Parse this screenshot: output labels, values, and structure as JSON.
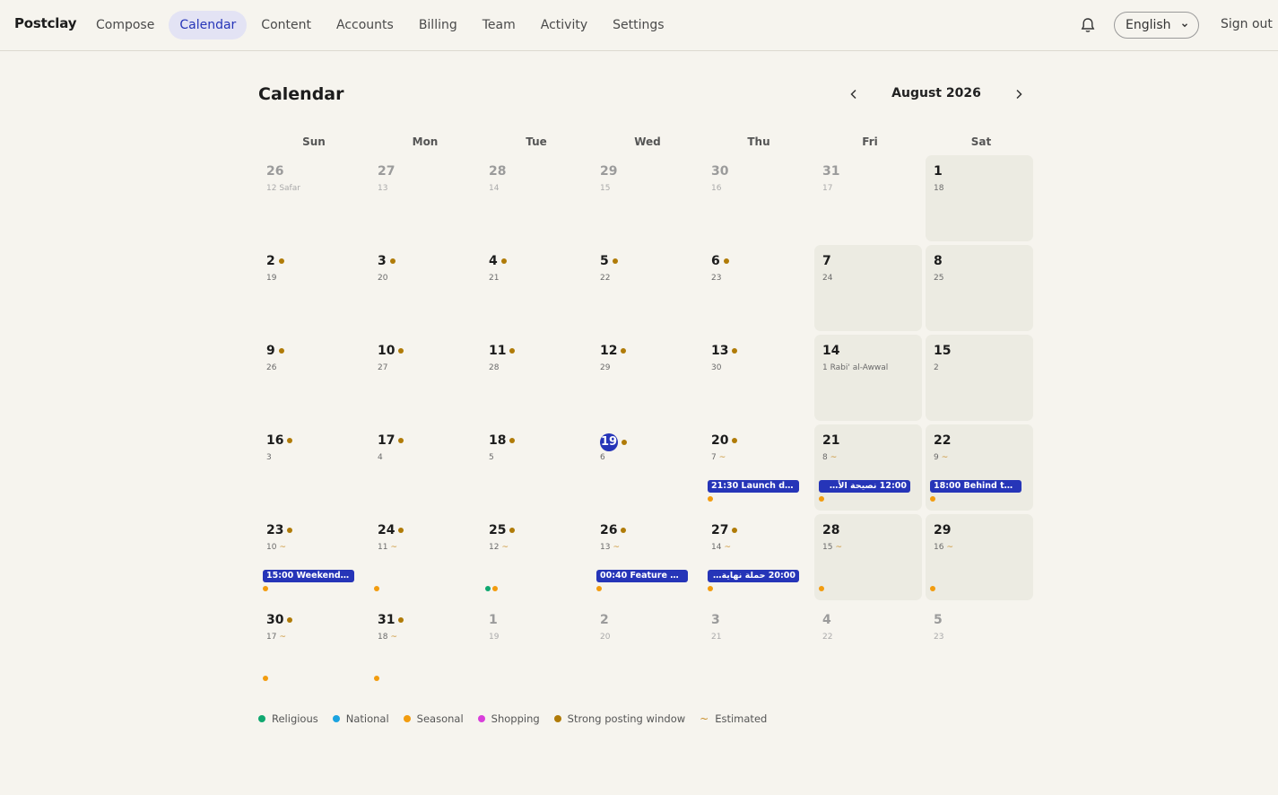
{
  "app": {
    "brand": "Postclay"
  },
  "nav": [
    "Compose",
    "Calendar",
    "Content",
    "Accounts",
    "Billing",
    "Team",
    "Activity",
    "Settings"
  ],
  "nav_active": 1,
  "header": {
    "language": "English",
    "sign_out": "Sign out"
  },
  "page": {
    "title": "Calendar",
    "month_label": "August 2026"
  },
  "weekdays": [
    "Sun",
    "Mon",
    "Tue",
    "Wed",
    "Thu",
    "Fri",
    "Sat"
  ],
  "colors": {
    "accent": "#2635b8",
    "religious": "#10a870",
    "national": "#1ba3e0",
    "seasonal": "#f29c0f",
    "shopping": "#d93fdb",
    "strong_window": "#b07b08",
    "estimated": "#c98f2b",
    "weekend_bg": "#ecebe2"
  },
  "calendar": {
    "weeks": [
      [
        {
          "day": "26",
          "hijri": "12 Safar",
          "other": true
        },
        {
          "day": "27",
          "hijri": "13",
          "other": true
        },
        {
          "day": "28",
          "hijri": "14",
          "other": true
        },
        {
          "day": "29",
          "hijri": "15",
          "other": true
        },
        {
          "day": "30",
          "hijri": "16",
          "other": true
        },
        {
          "day": "31",
          "hijri": "17",
          "other": true
        },
        {
          "day": "1",
          "hijri": "18"
        }
      ],
      [
        {
          "day": "2",
          "hijri": "19",
          "strong": true
        },
        {
          "day": "3",
          "hijri": "20",
          "strong": true
        },
        {
          "day": "4",
          "hijri": "21",
          "strong": true
        },
        {
          "day": "5",
          "hijri": "22",
          "strong": true
        },
        {
          "day": "6",
          "hijri": "23",
          "strong": true
        },
        {
          "day": "7",
          "hijri": "24"
        },
        {
          "day": "8",
          "hijri": "25"
        }
      ],
      [
        {
          "day": "9",
          "hijri": "26",
          "strong": true
        },
        {
          "day": "10",
          "hijri": "27",
          "strong": true
        },
        {
          "day": "11",
          "hijri": "28",
          "strong": true
        },
        {
          "day": "12",
          "hijri": "29",
          "strong": true
        },
        {
          "day": "13",
          "hijri": "30",
          "strong": true
        },
        {
          "day": "14",
          "hijri": "1 Rabi' al-Awwal"
        },
        {
          "day": "15",
          "hijri": "2"
        }
      ],
      [
        {
          "day": "16",
          "hijri": "3",
          "strong": true
        },
        {
          "day": "17",
          "hijri": "4",
          "strong": true
        },
        {
          "day": "18",
          "hijri": "5",
          "strong": true
        },
        {
          "day": "19",
          "hijri": "6",
          "strong": true,
          "today": true
        },
        {
          "day": "20",
          "hijri": "7",
          "estimated": true,
          "strong": true,
          "event": "21:30 Launch day ...",
          "dots": [
            "seasonal"
          ]
        },
        {
          "day": "21",
          "hijri": "8",
          "estimated": true,
          "event": "12:00  نصيحة الأسبو...",
          "event_rtl": true,
          "dots": [
            "seasonal"
          ]
        },
        {
          "day": "22",
          "hijri": "9",
          "estimated": true,
          "event": "18:00 Behind the ...",
          "dots": [
            "seasonal"
          ]
        }
      ],
      [
        {
          "day": "23",
          "hijri": "10",
          "estimated": true,
          "strong": true,
          "event": "15:00 Weekend re...",
          "dots": [
            "seasonal"
          ]
        },
        {
          "day": "24",
          "hijri": "11",
          "estimated": true,
          "strong": true,
          "dots": [
            "seasonal"
          ]
        },
        {
          "day": "25",
          "hijri": "12",
          "estimated": true,
          "strong": true,
          "dots": [
            "religious",
            "seasonal"
          ]
        },
        {
          "day": "26",
          "hijri": "13",
          "estimated": true,
          "strong": true,
          "event": "00:40 Feature de...",
          "dots": [
            "seasonal"
          ]
        },
        {
          "day": "27",
          "hijri": "14",
          "estimated": true,
          "strong": true,
          "event": "20:00  حملة نهاية الـ...",
          "event_rtl": true,
          "dots": [
            "seasonal"
          ]
        },
        {
          "day": "28",
          "hijri": "15",
          "estimated": true,
          "dots": [
            "seasonal"
          ]
        },
        {
          "day": "29",
          "hijri": "16",
          "estimated": true,
          "dots": [
            "seasonal"
          ]
        }
      ],
      [
        {
          "day": "30",
          "hijri": "17",
          "estimated": true,
          "strong": true,
          "dots": [
            "seasonal"
          ]
        },
        {
          "day": "31",
          "hijri": "18",
          "estimated": true,
          "strong": true,
          "dots": [
            "seasonal"
          ]
        },
        {
          "day": "1",
          "hijri": "19",
          "other": true
        },
        {
          "day": "2",
          "hijri": "20",
          "other": true
        },
        {
          "day": "3",
          "hijri": "21",
          "other": true
        },
        {
          "day": "4",
          "hijri": "22",
          "other": true
        },
        {
          "day": "5",
          "hijri": "23",
          "other": true
        }
      ]
    ]
  },
  "legend": [
    {
      "label": "Religious",
      "key": "religious"
    },
    {
      "label": "National",
      "key": "national"
    },
    {
      "label": "Seasonal",
      "key": "seasonal"
    },
    {
      "label": "Shopping",
      "key": "shopping"
    },
    {
      "label": "Strong posting window",
      "key": "strong_window"
    },
    {
      "label": "Estimated",
      "key": "estimated",
      "tilde": true
    }
  ],
  "estimated_symbol": "~"
}
